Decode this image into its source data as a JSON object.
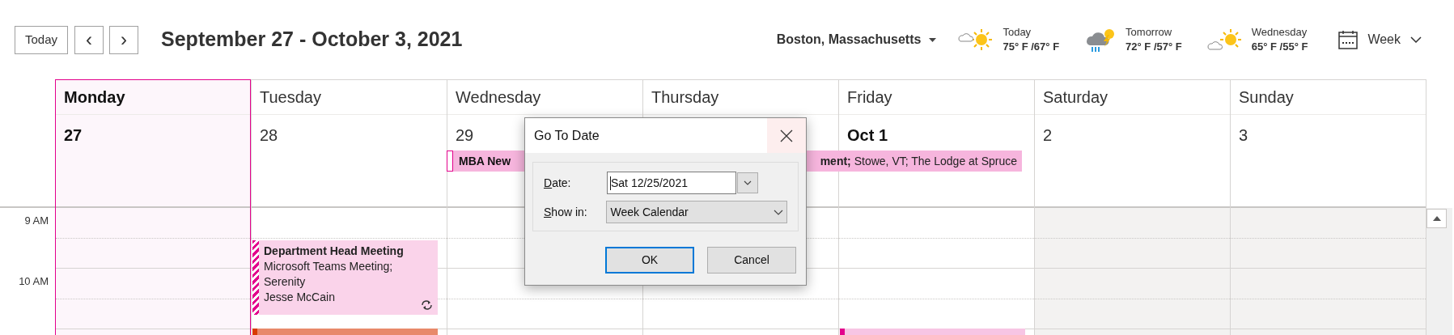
{
  "toolbar": {
    "today_button": "Today",
    "prev_button": "‹",
    "next_button": "›",
    "date_range": "September 27 - October 3, 2021",
    "location": "Boston, Massachusetts",
    "weather": [
      {
        "day": "Today",
        "temps": "75° F /67° F",
        "kind": "sun_cloud"
      },
      {
        "day": "Tomorrow",
        "temps": "72° F /57° F",
        "kind": "storm"
      },
      {
        "day": "Wednesday",
        "temps": "65° F /55° F",
        "kind": "cloud_sun"
      }
    ],
    "view": "Week"
  },
  "time_labels": [
    "9 AM",
    "10 AM"
  ],
  "days": [
    {
      "name": "Monday",
      "date": "27",
      "selected": true,
      "shaded": false
    },
    {
      "name": "Tuesday",
      "date": "28",
      "selected": false,
      "shaded": false,
      "events": [
        {
          "kind": "meeting",
          "title": "Department Head Meeting",
          "location": "Microsoft Teams Meeting; Serenity",
          "organizer": "Jesse McCain",
          "tentative": true,
          "recurring": true
        },
        {
          "kind": "cut",
          "color": "#e8896a"
        }
      ]
    },
    {
      "name": "Wednesday",
      "date": "29",
      "selected": false,
      "shaded": false
    },
    {
      "name": "Thursday",
      "selected": false,
      "shaded": false
    },
    {
      "name": "Friday",
      "date": "Oct 1",
      "selected": false,
      "shaded": false,
      "events": [
        {
          "kind": "cut",
          "color": "#f7c5e4"
        }
      ]
    },
    {
      "name": "Saturday",
      "date": "2",
      "selected": false,
      "shaded": true
    },
    {
      "name": "Sunday",
      "date": "3",
      "selected": false,
      "shaded": true
    }
  ],
  "all_day_event": {
    "visible_start": "MBA New",
    "visible_end": "**ment;** Stowe, VT; The Lodge at Spruce"
  },
  "dialog": {
    "title": "Go To Date",
    "date_label": "Date:",
    "date_value": "Sat 12/25/2021",
    "show_in_label": "Show in:",
    "show_in_value": "Week Calendar",
    "buttons": [
      {
        "label": "OK",
        "default": true
      },
      {
        "label": "Cancel",
        "default": false
      }
    ]
  }
}
